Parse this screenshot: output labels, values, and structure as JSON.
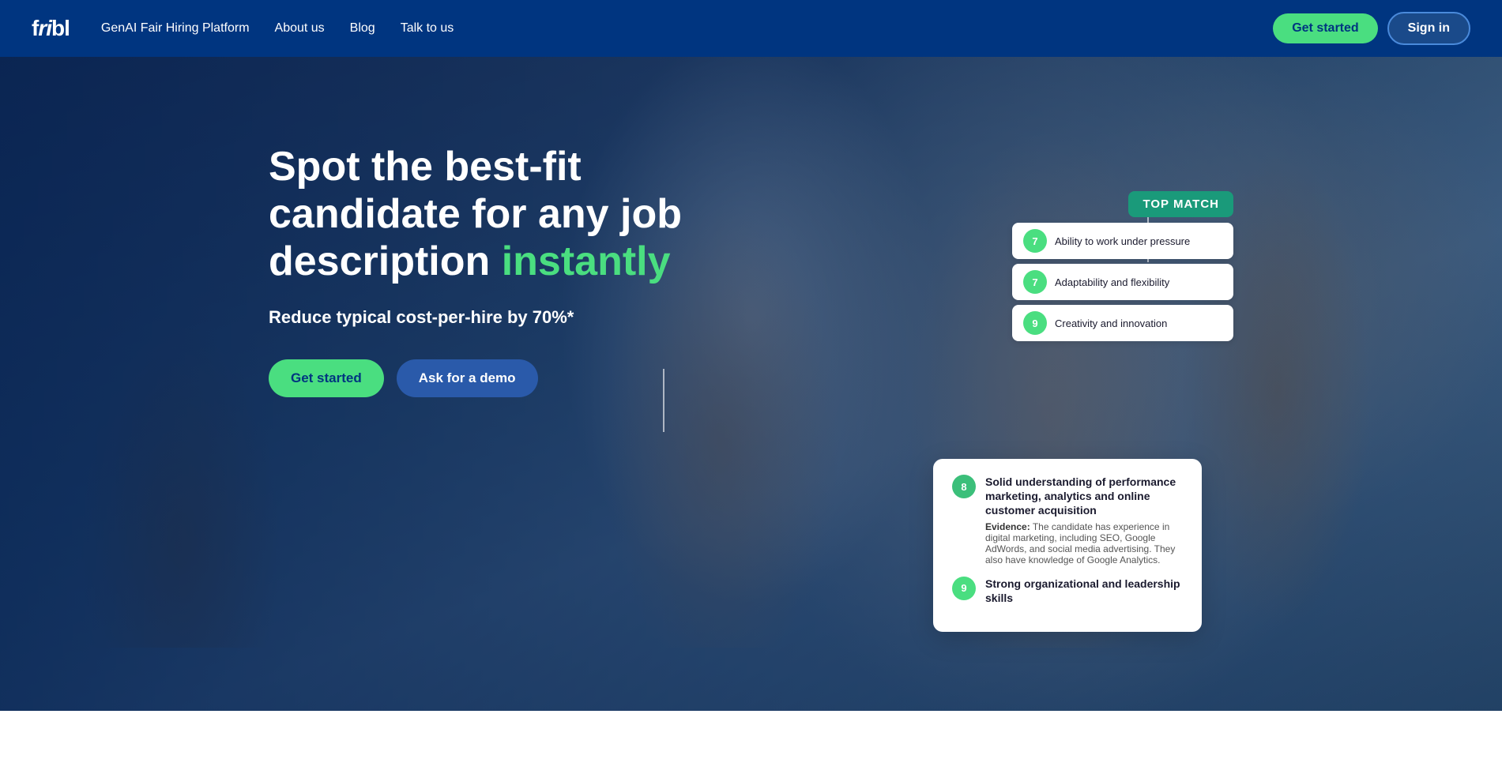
{
  "navbar": {
    "logo": "fribl",
    "nav_items": [
      {
        "label": "GenAI Fair Hiring Platform",
        "href": "#"
      },
      {
        "label": "About us",
        "href": "#"
      },
      {
        "label": "Blog",
        "href": "#"
      },
      {
        "label": "Talk to us",
        "href": "#"
      }
    ],
    "btn_get_started": "Get started",
    "btn_sign_in": "Sign in"
  },
  "hero": {
    "title_line1": "Spot the best-fit",
    "title_line2": "candidate for any job",
    "title_line3": "description ",
    "title_highlight": "instantly",
    "subtitle": "Reduce typical cost-per-hire by 70%*",
    "btn_get_started": "Get started",
    "btn_demo": "Ask for a demo"
  },
  "top_match_badge": "TOP MATCH",
  "floating_items": [
    {
      "score": "7",
      "text": "Ability to work under pressure"
    },
    {
      "score": "7",
      "text": "Adaptability and flexibility"
    },
    {
      "score": "9",
      "text": "Creativity and innovation"
    }
  ],
  "score_card": {
    "main_item": {
      "score": "8",
      "title": "Solid understanding of performance marketing, analytics and online customer acquisition",
      "evidence_label": "Evidence:",
      "evidence": "The candidate has experience in digital marketing, including SEO, Google AdWords, and social media advertising. They also have knowledge of Google Analytics."
    },
    "bottom_item": {
      "score": "9",
      "title": "Strong organizational and leadership skills"
    }
  },
  "bottom_section": {
    "text": ""
  }
}
